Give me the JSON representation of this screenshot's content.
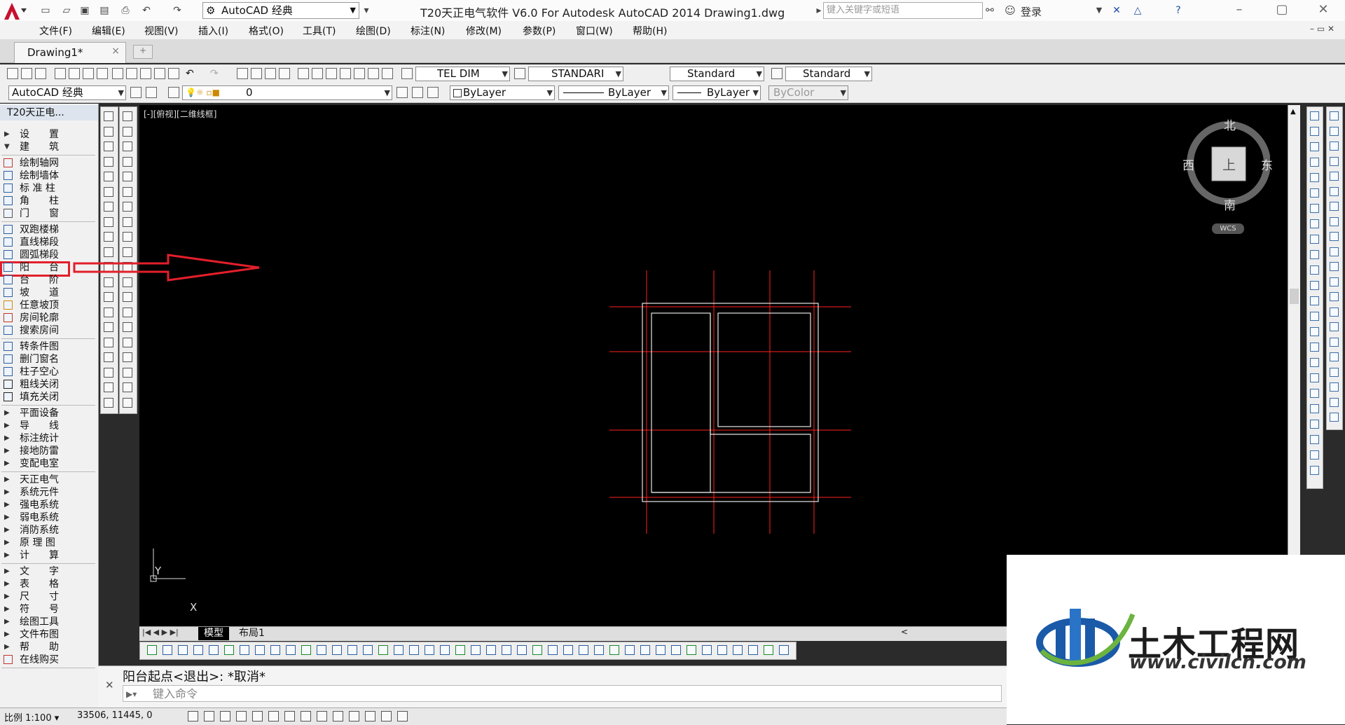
{
  "titlebar": {
    "workspace": "AutoCAD 经典",
    "title": "T20天正电气软件 V6.0 For Autodesk AutoCAD 2014    Drawing1.dwg",
    "search_placeholder": "键入关键字或短语",
    "signin": "登录"
  },
  "menubar": [
    "文件(F)",
    "编辑(E)",
    "视图(V)",
    "插入(I)",
    "格式(O)",
    "工具(T)",
    "绘图(D)",
    "标注(N)",
    "修改(M)",
    "参数(P)",
    "窗口(W)",
    "帮助(H)"
  ],
  "document_tab": {
    "label": "Drawing1*",
    "close": "×"
  },
  "styles_toolbar": {
    "text_style": "TEL DIM",
    "dim_style": "STANDARI",
    "table_style": "Standard",
    "multileader_style": "Standard"
  },
  "layers_toolbar": {
    "workspace": "AutoCAD 经典",
    "layer": "0",
    "color": "ByLayer",
    "linetype": "ByLayer",
    "lineweight": "ByLayer",
    "plotstyle": "ByColor"
  },
  "left_panel": {
    "title": "T20天正电...",
    "groups": [
      [
        {
          "label": "设　　置",
          "type": "group-collapsed"
        },
        {
          "label": "建　　筑",
          "type": "group-expanded"
        }
      ],
      [
        {
          "label": "绘制轴网",
          "icon": "grid-icon"
        },
        {
          "label": "绘制墙体",
          "icon": "wall-icon"
        },
        {
          "label": "标 准 柱",
          "icon": "column-icon"
        },
        {
          "label": "角　　柱",
          "icon": "corner-column-icon"
        },
        {
          "label": "门　　窗",
          "icon": "door-icon"
        }
      ],
      [
        {
          "label": "双跑楼梯",
          "icon": "stair-icon"
        },
        {
          "label": "直线梯段",
          "icon": "stair-straight-icon"
        },
        {
          "label": "圆弧梯段",
          "icon": "stair-arc-icon"
        },
        {
          "label": "阳　　台",
          "icon": "balcony-icon"
        },
        {
          "label": "台　　阶",
          "icon": "step-icon"
        },
        {
          "label": "坡　　道",
          "icon": "ramp-icon"
        },
        {
          "label": "任意坡顶",
          "icon": "roof-icon"
        },
        {
          "label": "房间轮廓",
          "icon": "room-outline-icon"
        },
        {
          "label": "搜索房间",
          "icon": "search-room-icon"
        }
      ],
      [
        {
          "label": "转条件图",
          "icon": "convert-icon"
        },
        {
          "label": "删门窗名",
          "icon": "delete-name-icon"
        },
        {
          "label": "柱子空心",
          "icon": "hollow-column-icon"
        },
        {
          "label": "粗线关闭",
          "icon": "bulb-icon"
        },
        {
          "label": "填充关闭",
          "icon": "bulb-icon"
        }
      ],
      [
        {
          "label": "平面设备",
          "type": "group-collapsed"
        },
        {
          "label": "导　　线",
          "type": "group-collapsed"
        },
        {
          "label": "标注统计",
          "type": "group-collapsed"
        },
        {
          "label": "接地防雷",
          "type": "group-collapsed"
        },
        {
          "label": "变配电室",
          "type": "group-collapsed"
        }
      ],
      [
        {
          "label": "天正电气",
          "type": "group-collapsed"
        },
        {
          "label": "系统元件",
          "type": "group-collapsed"
        },
        {
          "label": "强电系统",
          "type": "group-collapsed"
        },
        {
          "label": "弱电系统",
          "type": "group-collapsed"
        },
        {
          "label": "消防系统",
          "type": "group-collapsed"
        },
        {
          "label": "原 理 图",
          "type": "group-collapsed"
        },
        {
          "label": "计　　算",
          "type": "group-collapsed"
        }
      ],
      [
        {
          "label": "文　　字",
          "type": "group-collapsed"
        },
        {
          "label": "表　　格",
          "type": "group-collapsed"
        },
        {
          "label": "尺　　寸",
          "type": "group-collapsed"
        },
        {
          "label": "符　　号",
          "type": "group-collapsed"
        },
        {
          "label": "绘图工具",
          "type": "group-collapsed"
        },
        {
          "label": "文件布图",
          "type": "group-collapsed"
        },
        {
          "label": "帮　　助",
          "type": "group-collapsed"
        },
        {
          "label": "在线购买",
          "icon": "cart-icon"
        }
      ]
    ]
  },
  "canvas": {
    "view_label": "[-][俯视][二维线框]",
    "viewcube": {
      "north": "北",
      "south": "南",
      "east": "东",
      "west": "西",
      "face": "上",
      "wcs": "WCS"
    },
    "ucs": {
      "x": "X",
      "y": "Y"
    }
  },
  "layout_tabs": {
    "model": "模型",
    "layout1": "布局1"
  },
  "command": {
    "history": "阳台起点<退出>: *取消*",
    "placeholder": "键入命令"
  },
  "status": {
    "scale": "比例 1:100",
    "coords": "33506,  11445,  0"
  },
  "watermark": {
    "title": "土木工程网",
    "url": "www.civilcn.com"
  },
  "colors": {
    "highlight": "#e21f2a",
    "grid_lines": "#ff2020",
    "walls": "#e6e6e6",
    "canvas": "#000000"
  }
}
